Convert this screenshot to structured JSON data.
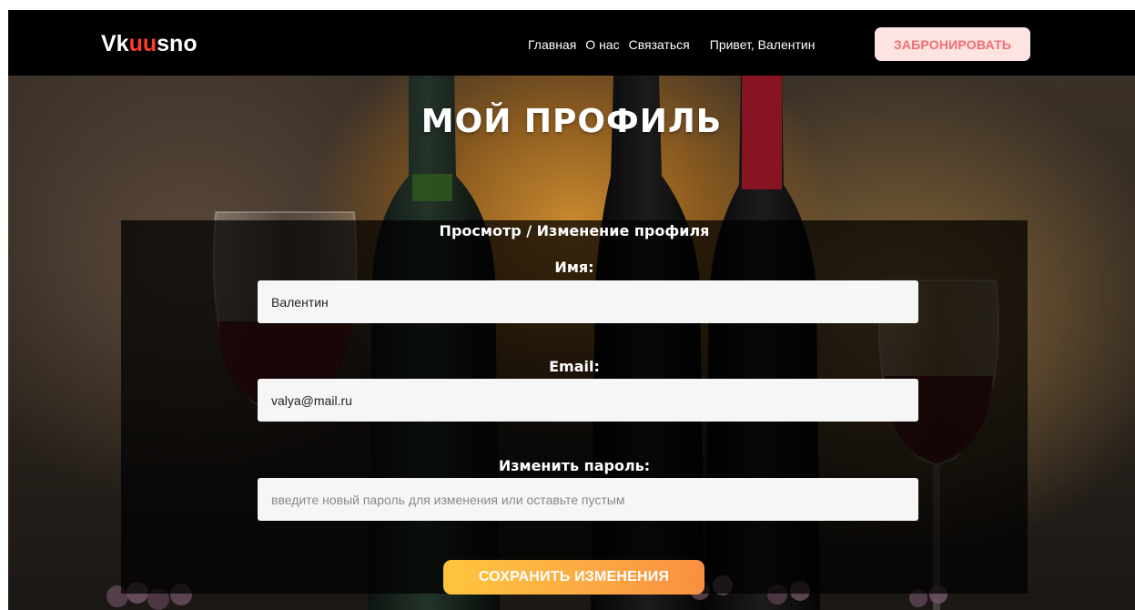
{
  "navbar": {
    "logo_prefix": "Vk",
    "logo_accent": "uu",
    "logo_suffix": "sno",
    "links": {
      "home": "Главная",
      "about": "О нас",
      "contact": "Связаться",
      "greeting": "Привет, Валентин"
    },
    "book_button": "ЗАБРОНИРОВАТЬ"
  },
  "page": {
    "title": "МОЙ ПРОФИЛЬ"
  },
  "profile_form": {
    "heading": "Просмотр / Изменение профиля",
    "name": {
      "label": "Имя:",
      "value": "Валентин"
    },
    "email": {
      "label": "Email:",
      "value": "valya@mail.ru"
    },
    "password": {
      "label": "Изменить пароль:",
      "value": "",
      "placeholder": "введите новый пароль для изменения или оставьте пустым"
    },
    "save_button": "СОХРАНИТЬ ИЗМЕНЕНИЯ"
  },
  "colors": {
    "logo_accent": "#ff3b2f",
    "book_button_bg": "#fde3e1",
    "book_button_text": "#ef6f73",
    "save_button_start": "#fec53d",
    "save_button_end": "#f98f3f"
  }
}
